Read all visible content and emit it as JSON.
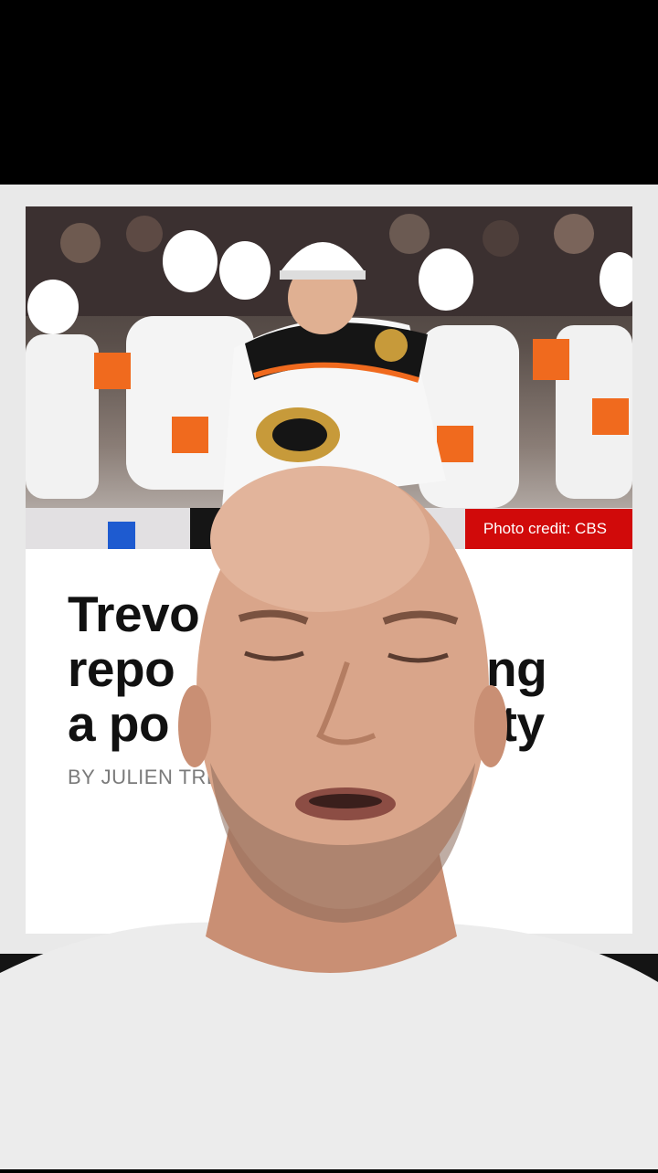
{
  "article": {
    "photo_credit": "Photo credit: CBS",
    "headline_lines": [
      "Trevo",
      "repo",
      "a po"
    ],
    "headline_fragments": [
      "ng",
      "rity"
    ],
    "byline": "BY JULIEN TREI"
  },
  "colors": {
    "credit_badge": "#d10a0a",
    "jersey_orange": "#f06a1e",
    "jersey_white": "#f4f4f4",
    "jersey_black": "#151515",
    "shirt": "#ececec",
    "skin": "#d9a58a"
  }
}
